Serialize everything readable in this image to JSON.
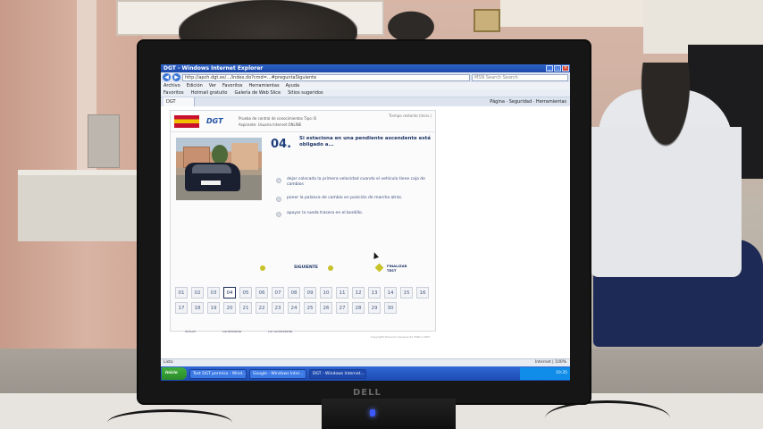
{
  "ie": {
    "title": "DGT - Windows Internet Explorer",
    "url": "http://apch.dgt.es/.../index.do?cmd=...#preguntaSiguiente",
    "search_placeholder": "MSN Search Search",
    "menu": [
      "Archivo",
      "Edición",
      "Ver",
      "Favoritos",
      "Herramientas",
      "Ayuda"
    ],
    "favorites": [
      "Favoritos",
      "Hotmail gratuito",
      "Galería de Web Slice",
      "Sitios sugeridos"
    ],
    "tab_label": "DGT",
    "toolbar_right": "Página  ·  Seguridad  ·  Herramientas"
  },
  "test": {
    "header_line1": "Prueba de control de conocimientos    Tipo: B",
    "header_line2": "Aspirante: Usuario Internet    ONLINE",
    "time_label": "Tiempo restante (mins.)",
    "question_number": "04.",
    "question_text": "Si estaciona en una pendiente ascendente está obligado a...",
    "answers": [
      "dejar colocada la primera velocidad cuando el vehículo tiene caja de cambios",
      "poner la palanca de cambio en posición de marcha atrás.",
      "apoyar la rueda trasera en el bordillo."
    ],
    "next_label": "SIGUIENTE",
    "finish_label": "FINALIZAR TEST",
    "grid_row1": [
      "01",
      "02",
      "03",
      "04",
      "05",
      "06",
      "07",
      "08",
      "09",
      "10",
      "11",
      "12",
      "13",
      "14",
      "15",
      "16"
    ],
    "grid_row2": [
      "17",
      "18",
      "19",
      "20",
      "21",
      "22",
      "23",
      "24",
      "25",
      "26",
      "27",
      "28",
      "29",
      "30"
    ],
    "current_question": "04",
    "legend": [
      "Actual",
      "contestada",
      "no contestada"
    ],
    "copyright": "Copyright Dirección General de Tráfico 2007"
  },
  "status": {
    "left": "Listo",
    "right": "Internet  |  100%"
  },
  "taskbar": {
    "start": "Inicio",
    "tasks": [
      "Test DGT permiso - Wind...",
      "Google - Windows Inter...",
      "DGT - Windows Internet..."
    ],
    "clock": "10:35"
  },
  "monitor_brand": "DELL",
  "colors": {
    "question_blue": "#1d3566",
    "taskbar_blue": "#1d4bb4",
    "accent_yellow": "#c8c22a"
  }
}
